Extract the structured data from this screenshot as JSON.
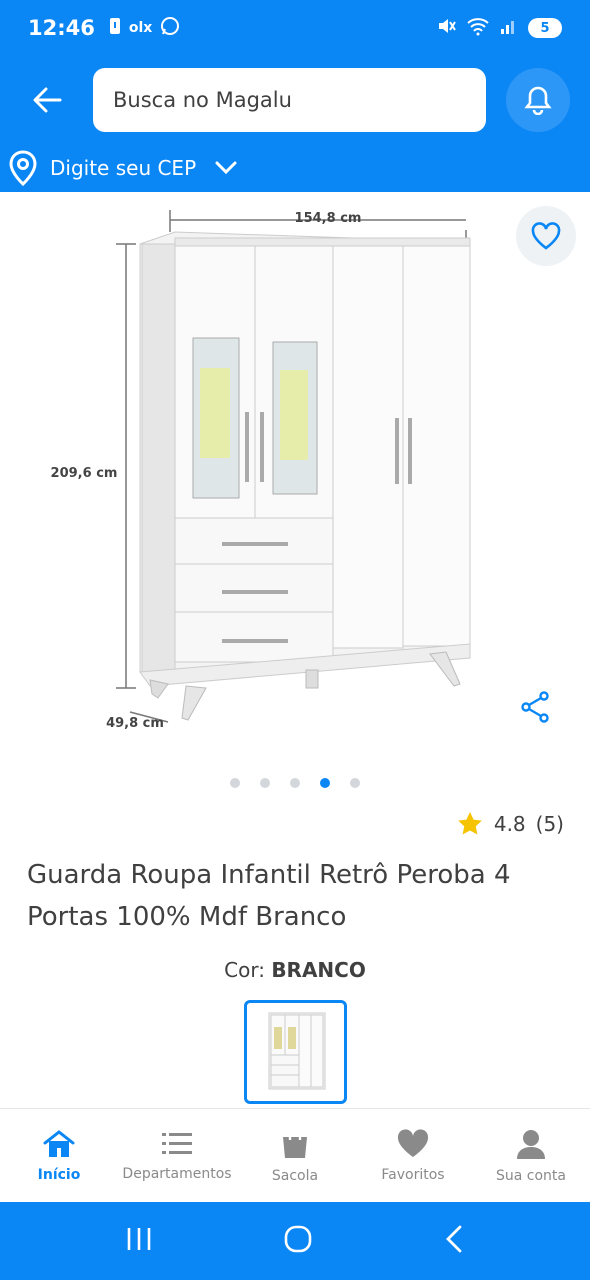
{
  "status_bar": {
    "time": "12:46",
    "notif_text": "olx",
    "battery": "5"
  },
  "header": {
    "search_placeholder": "Busca no Magalu",
    "cep_label": "Digite seu CEP"
  },
  "product": {
    "dimensions": {
      "width": "154,8 cm",
      "height": "209,6 cm",
      "depth": "49,8 cm"
    },
    "carousel": {
      "count": 5,
      "active": 3
    },
    "rating": "4.8",
    "reviews": "(5)",
    "title": "Guarda Roupa Infantil Retrô Peroba 4 Portas 100% Mdf Branco",
    "color_label": "Cor:",
    "color_value": "BRANCO"
  },
  "tabs": [
    {
      "label": "Início",
      "icon": "home-icon",
      "active": true
    },
    {
      "label": "Departamentos",
      "icon": "list-icon"
    },
    {
      "label": "Sacola",
      "icon": "bag-icon"
    },
    {
      "label": "Favoritos",
      "icon": "heart-icon"
    },
    {
      "label": "Sua conta",
      "icon": "user-icon"
    }
  ],
  "colors": {
    "brand_blue": "#0a86f5",
    "star": "#f5c300",
    "text": "#404040"
  }
}
